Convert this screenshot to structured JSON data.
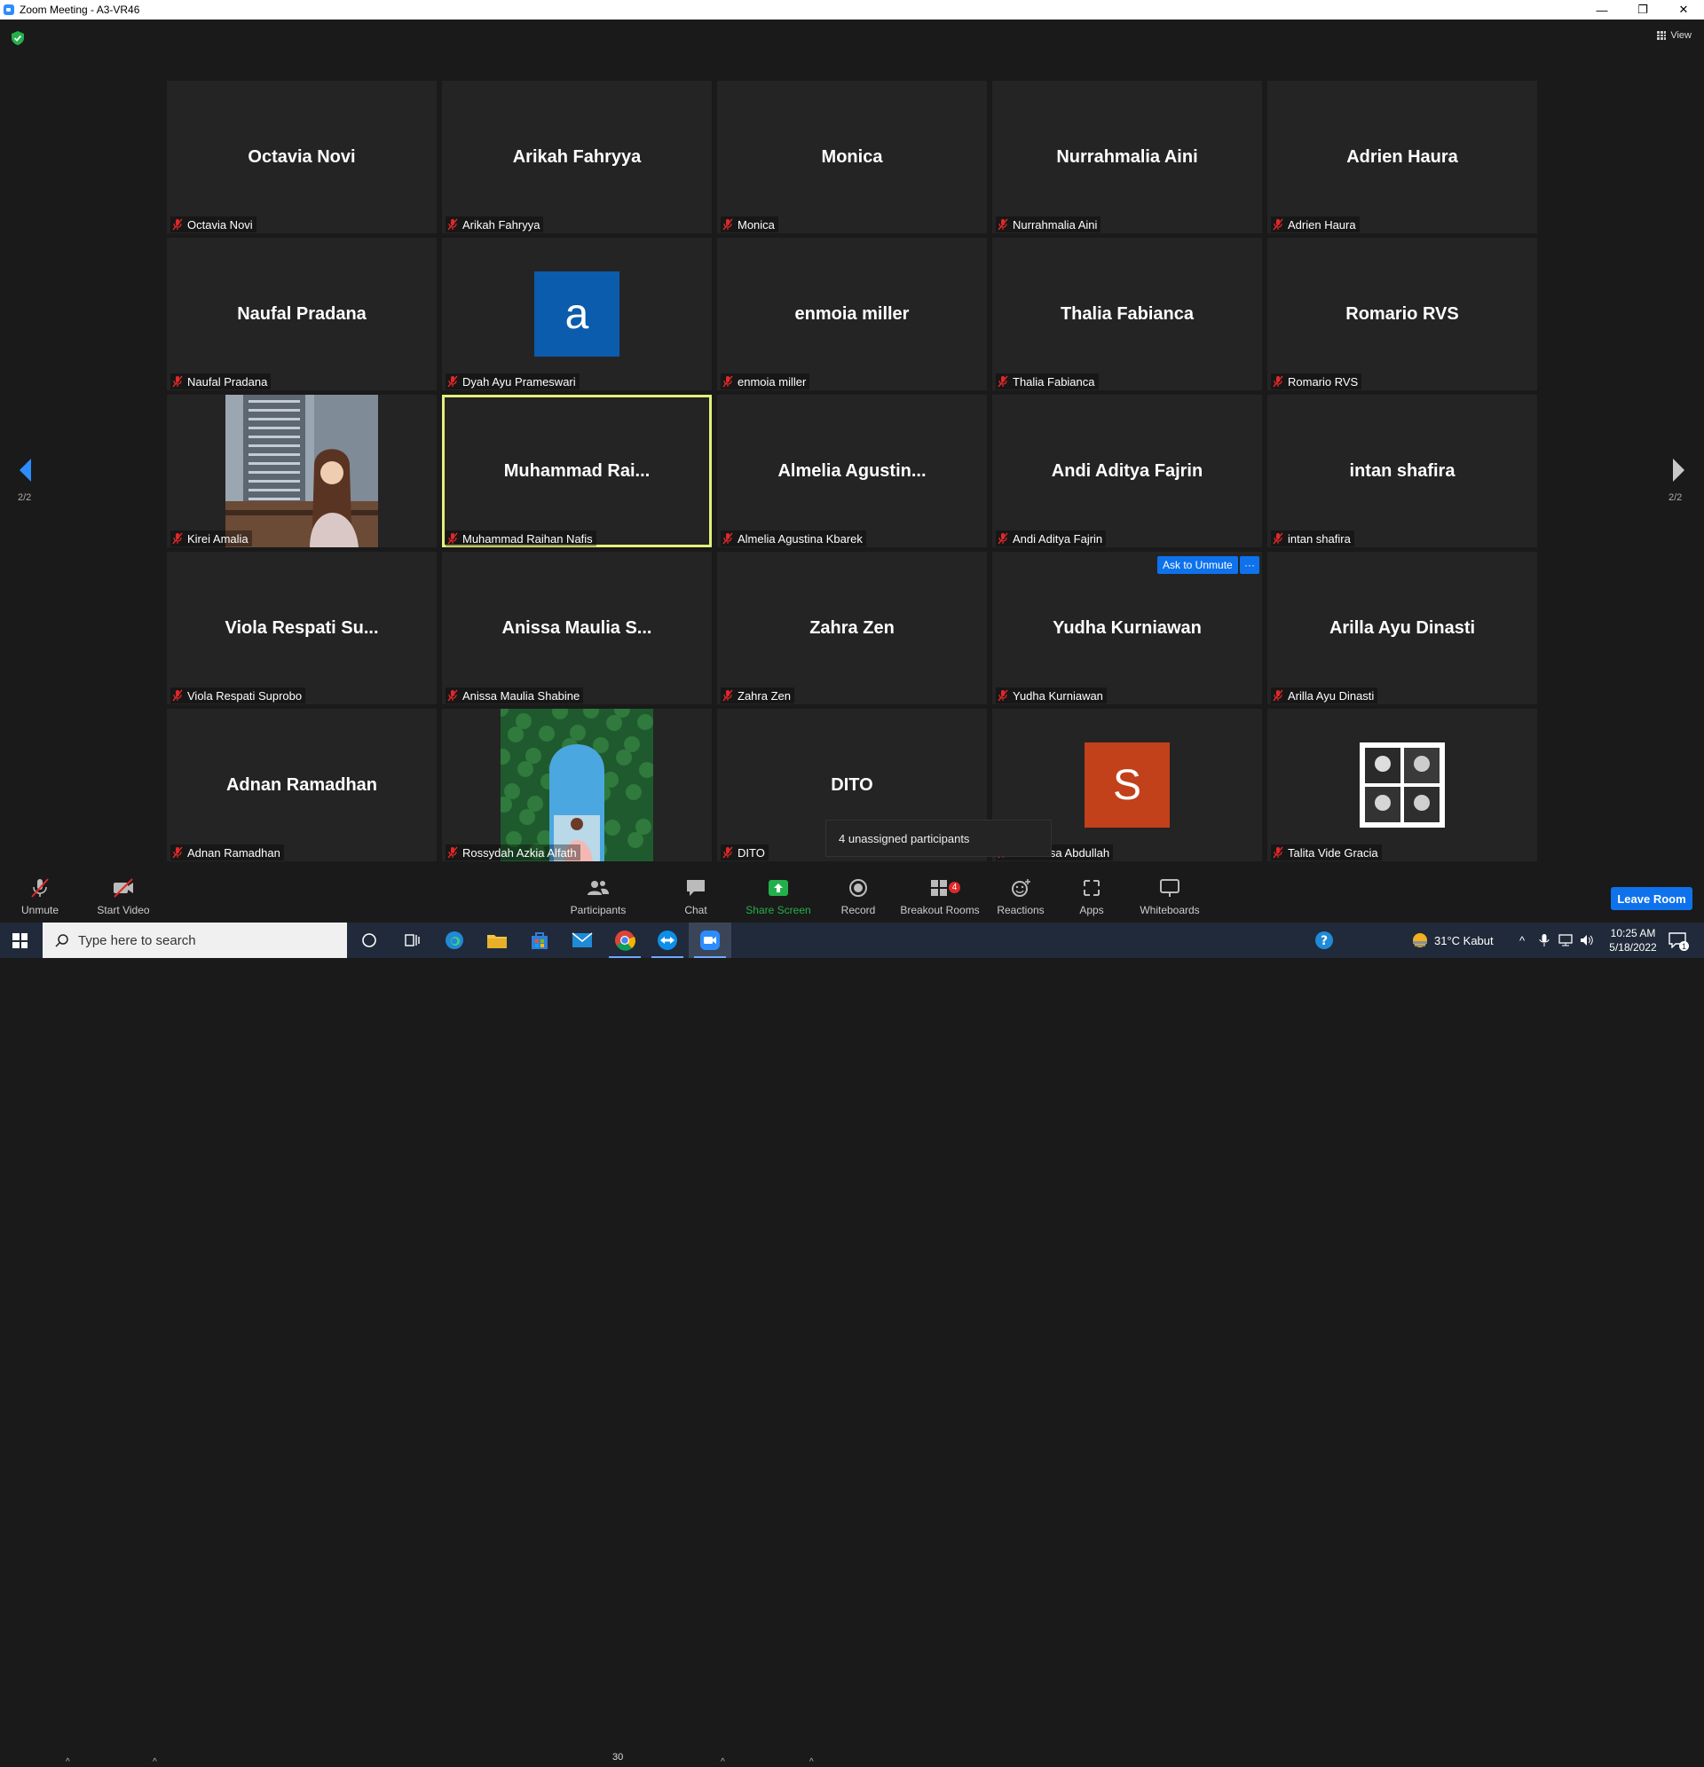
{
  "window": {
    "title": "Zoom Meeting - A3-VR46",
    "controls": [
      "—",
      "❐",
      "✕"
    ]
  },
  "top": {
    "view_label": "View"
  },
  "pager": {
    "left_page": "2/2",
    "right_page": "2/2"
  },
  "tiles": [
    {
      "big": "Octavia Novi",
      "label": "Octavia Novi"
    },
    {
      "big": "Arikah Fahryya",
      "label": "Arikah Fahryya"
    },
    {
      "big": "Monica",
      "label": "Monica"
    },
    {
      "big": "Nurrahmalia Aini",
      "label": "Nurrahmalia Aini"
    },
    {
      "big": "Adrien Haura",
      "label": "Adrien Haura"
    },
    {
      "big": "Naufal Pradana",
      "label": "Naufal Pradana"
    },
    {
      "big": "",
      "avatar_letter": "a",
      "avatar_color": "#0b5cad",
      "label": "Dyah Ayu Prameswari"
    },
    {
      "big": "enmoia miller",
      "label": "enmoia miller"
    },
    {
      "big": "Thalia Fabianca",
      "label": "Thalia Fabianca"
    },
    {
      "big": "Romario RVS",
      "label": "Romario RVS"
    },
    {
      "big": "",
      "photo": "building",
      "label": "Kirei Amalia"
    },
    {
      "big": "Muhammad  Rai...",
      "label": "Muhammad Raihan Nafis",
      "active": true
    },
    {
      "big": "Almelia  Agustin...",
      "label": "Almelia Agustina Kbarek"
    },
    {
      "big": "Andi Aditya Fajrin",
      "label": "Andi Aditya Fajrin"
    },
    {
      "big": "intan shafira",
      "label": "intan shafira"
    },
    {
      "big": "Viola Respati Su...",
      "label": "Viola Respati Suprobo"
    },
    {
      "big": "Anissa Maulia S...",
      "label": "Anissa Maulia Shabine"
    },
    {
      "big": "Zahra Zen",
      "label": "Zahra Zen"
    },
    {
      "big": "Yudha Kurniawan",
      "label": "Yudha Kurniawan"
    },
    {
      "big": "Arilla Ayu Dinasti",
      "label": "Arilla Ayu Dinasti"
    },
    {
      "big": "Adnan Ramadhan",
      "label": "Adnan Ramadhan"
    },
    {
      "big": "",
      "photo": "garden",
      "label": "Rossydah Azkia Alfath"
    },
    {
      "big": "DITO",
      "label": "DITO"
    },
    {
      "big": "",
      "avatar_letter": "S",
      "avatar_color": "#c2401a",
      "label": "hairulnisa Abdullah"
    },
    {
      "big": "",
      "photo": "collage",
      "label": "Talita Vide Gracia"
    }
  ],
  "hover_actions": {
    "ask_unmute": "Ask to Unmute",
    "more": "···"
  },
  "tooltip": "4 unassigned participants",
  "toolbar": {
    "unmute": "Unmute",
    "start_video": "Start Video",
    "participants": "Participants",
    "participants_count": "30",
    "chat": "Chat",
    "share_screen": "Share Screen",
    "record": "Record",
    "breakout_rooms": "Breakout Rooms",
    "breakout_badge": "4",
    "reactions": "Reactions",
    "apps": "Apps",
    "whiteboards": "Whiteboards",
    "leave_room": "Leave Room"
  },
  "taskbar": {
    "search_placeholder": "Type here to search",
    "weather": "31°C  Kabut",
    "time": "10:25 AM",
    "date": "5/18/2022",
    "notif_count": "1"
  },
  "colors": {
    "accent": "#0e72ed",
    "active_speaker": "#e3f07a",
    "share_green": "#23b04a",
    "mute_red": "#e02828"
  }
}
